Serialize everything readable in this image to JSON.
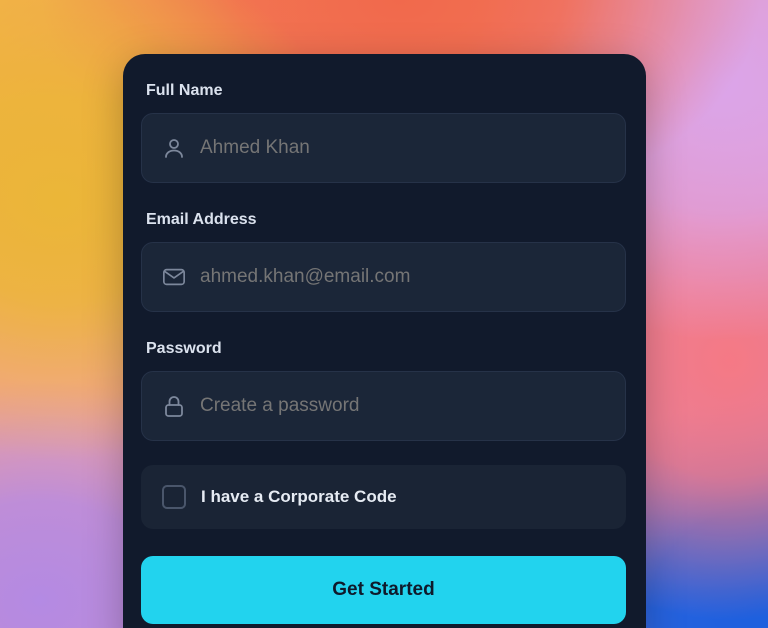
{
  "form": {
    "full_name": {
      "label": "Full Name",
      "placeholder": "Ahmed Khan",
      "icon": "user-icon"
    },
    "email": {
      "label": "Email Address",
      "placeholder": "ahmed.khan@email.com",
      "icon": "mail-icon"
    },
    "password": {
      "label": "Password",
      "placeholder": "Create a password",
      "icon": "lock-icon"
    },
    "corporate_code": {
      "label": "I have a Corporate Code",
      "checked": false
    },
    "submit_label": "Get Started"
  },
  "colors": {
    "card_bg": "#111a2c",
    "input_bg": "#1b2638",
    "accent": "#22d3ee",
    "placeholder": "#4d5a70"
  }
}
